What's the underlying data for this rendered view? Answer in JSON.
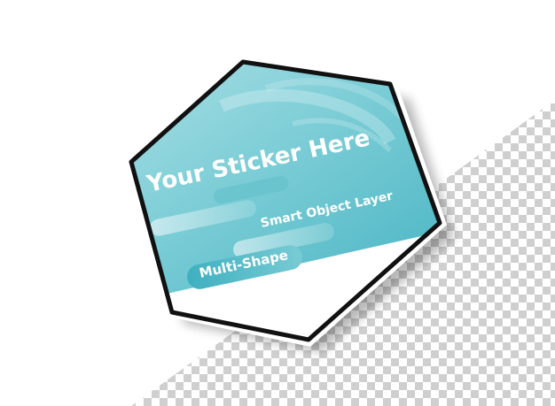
{
  "sticker": {
    "title": "Your Sticker Here",
    "subtitle": "Smart Object Layer",
    "badge_label": "Multi-Shape"
  },
  "colors": {
    "background": "#ffffff",
    "checker_light": "#ffffff",
    "checker_dark": "#cfcfcf",
    "teal_light": "#b4e3e8",
    "teal_mid": "#7ccdd6",
    "teal_dark": "#3fb0c0",
    "border": "#111111",
    "text_white": "#ffffff"
  }
}
